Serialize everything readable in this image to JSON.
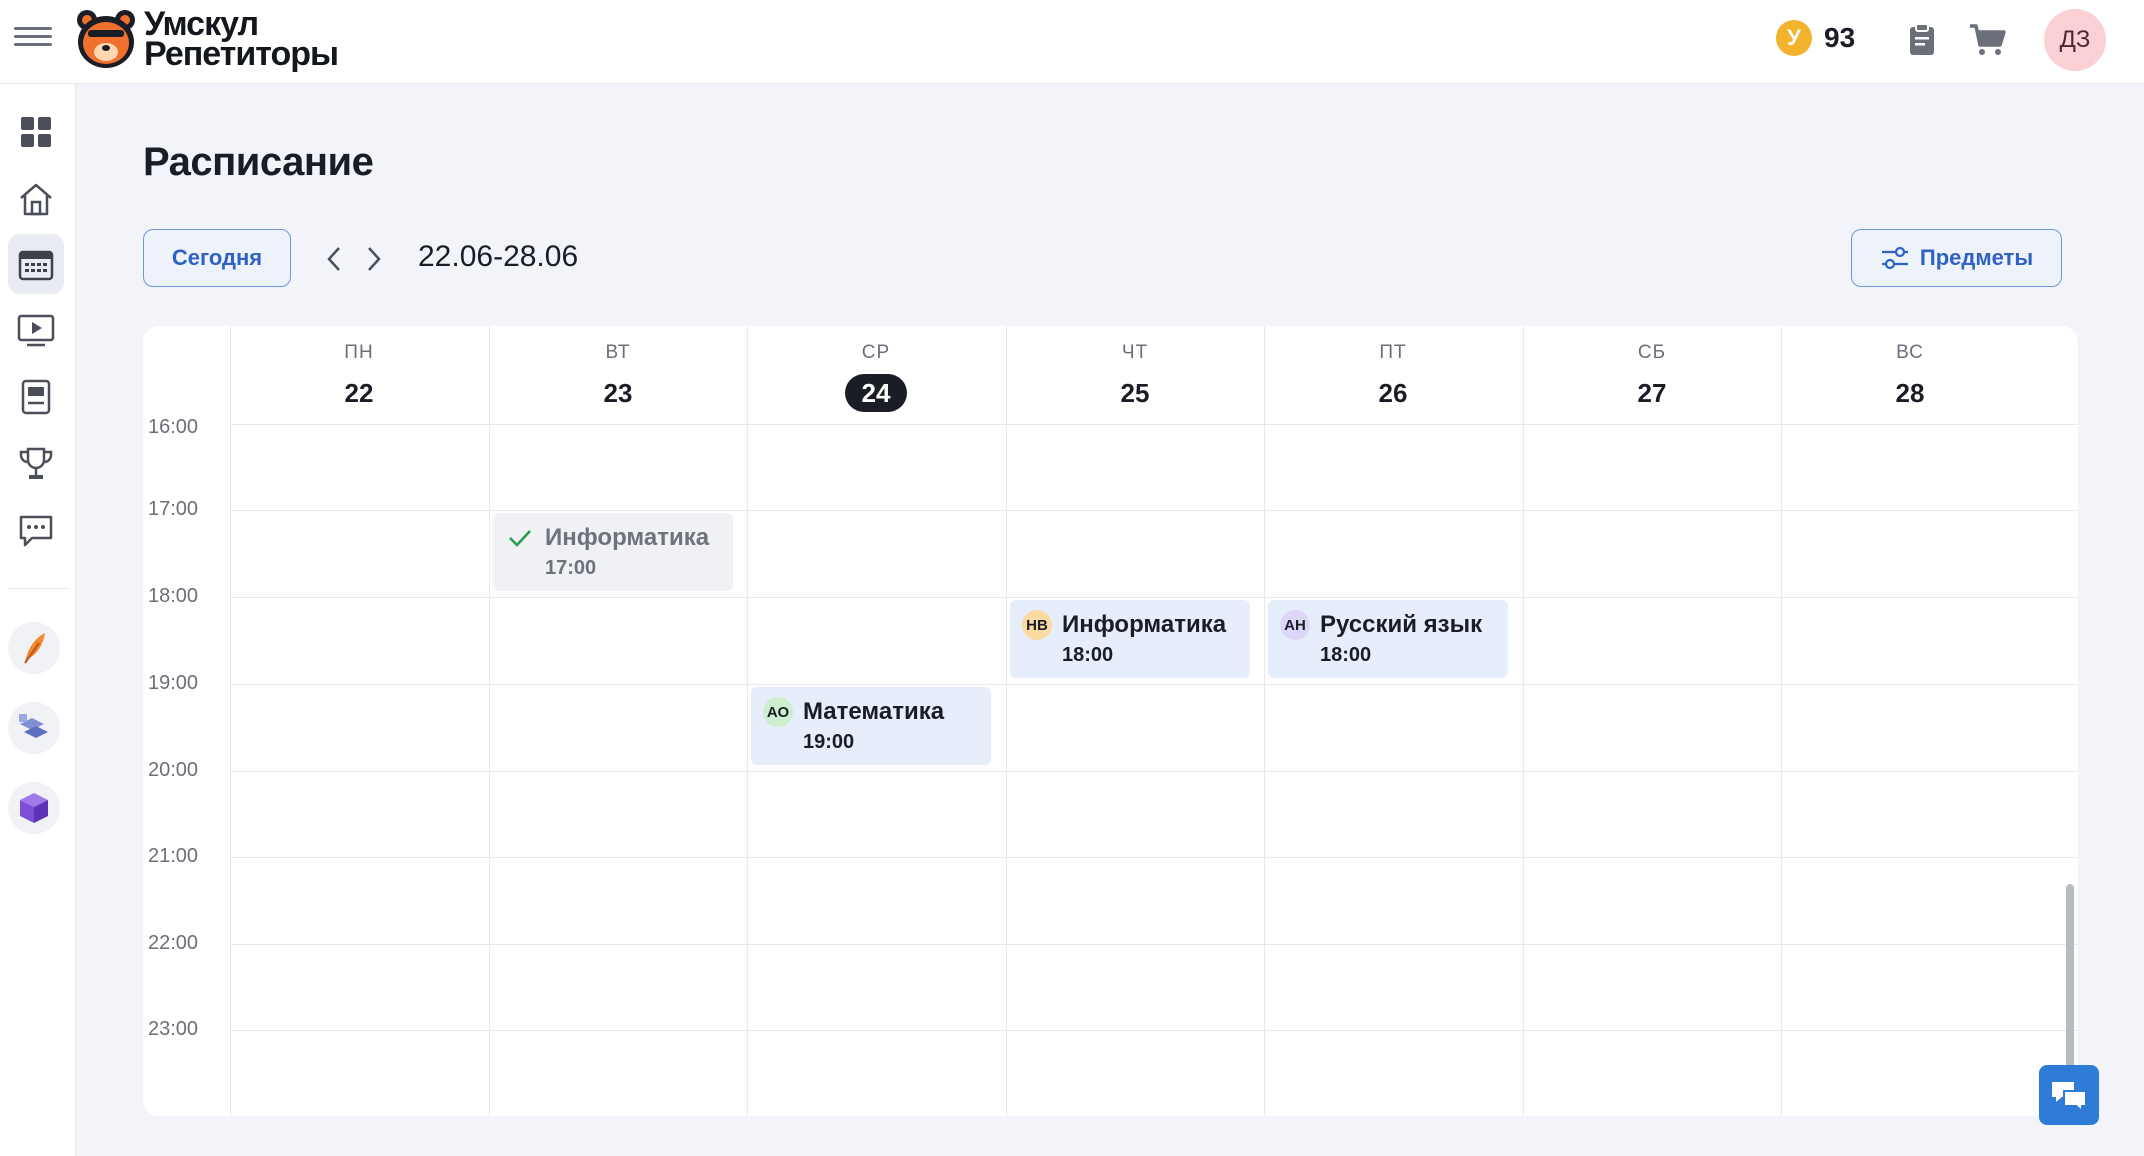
{
  "header": {
    "logo_line1": "Умскул",
    "logo_line2": "Репетиторы",
    "coin_symbol": "У",
    "coins": "93",
    "avatar_initials": "ДЗ"
  },
  "sidebar": {
    "items": [
      {
        "name": "dashboard",
        "icon": "grid-icon"
      },
      {
        "name": "home",
        "icon": "home-icon"
      },
      {
        "name": "schedule",
        "icon": "calendar-icon",
        "active": true
      },
      {
        "name": "video",
        "icon": "play-icon"
      },
      {
        "name": "homework",
        "icon": "notebook-icon"
      },
      {
        "name": "achievements",
        "icon": "trophy-icon"
      },
      {
        "name": "chat",
        "icon": "chat-icon"
      }
    ],
    "apps": [
      "feather-app-icon",
      "blocks-app-icon",
      "cube-app-icon"
    ]
  },
  "main": {
    "title": "Расписание",
    "today_label": "Сегодня",
    "date_range": "22.06-28.06",
    "subjects_label": "Предметы"
  },
  "calendar": {
    "days": [
      {
        "name": "ПН",
        "num": "22"
      },
      {
        "name": "ВТ",
        "num": "23"
      },
      {
        "name": "СР",
        "num": "24",
        "today": true
      },
      {
        "name": "ЧТ",
        "num": "25"
      },
      {
        "name": "ПТ",
        "num": "26"
      },
      {
        "name": "СБ",
        "num": "27"
      },
      {
        "name": "ВС",
        "num": "28"
      }
    ],
    "hours": [
      "16:00",
      "17:00",
      "18:00",
      "19:00",
      "20:00",
      "21:00",
      "22:00",
      "23:00"
    ],
    "events": [
      {
        "day": 1,
        "start_hour": "17:00",
        "title": "Информатика",
        "time": "17:00",
        "badge": "",
        "completed": true
      },
      {
        "day": 3,
        "start_hour": "18:00",
        "title": "Информатика",
        "time": "18:00",
        "badge": "НВ",
        "badge_color": "#fbd9a3",
        "completed": false
      },
      {
        "day": 4,
        "start_hour": "18:00",
        "title": "Русский язык",
        "time": "18:00",
        "badge": "АН",
        "badge_color": "#dcd6f7",
        "completed": false
      },
      {
        "day": 2,
        "start_hour": "19:00",
        "title": "Математика",
        "time": "19:00",
        "badge": "АО",
        "badge_color": "#cdeecf",
        "completed": false
      }
    ]
  },
  "colors": {
    "accent": "#2f62c3",
    "today_bg": "#1b1d26",
    "event_bg": "#e7eefb",
    "event_done_bg": "#f0f1f4",
    "check": "#2e9a52",
    "chat_fab": "#2e7cd6"
  }
}
